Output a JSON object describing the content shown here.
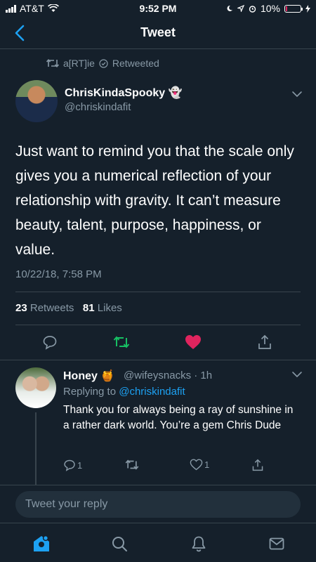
{
  "status": {
    "carrier": "AT&T",
    "time": "9:52 PM",
    "battery": "10%"
  },
  "header": {
    "title": "Tweet"
  },
  "retweet": {
    "label": "a[RT]ie",
    "suffix": "Retweeted"
  },
  "tweet": {
    "name": "ChrisKindaSpooky",
    "handle": "@chriskindafit",
    "text": "Just want to remind you that the scale only gives you a numerical reflection of your relationship with gravity. It can’t measure beauty, talent, purpose, happiness, or value.",
    "timestamp": "10/22/18, 7:58 PM",
    "retweets_count": "23",
    "retweets_label": "Retweets",
    "likes_count": "81",
    "likes_label": "Likes"
  },
  "reply": {
    "name": "Honey",
    "handle_time": "@wifeysnacks · 1h",
    "replying_prefix": "Replying to",
    "replying_handle": "@chriskindafit",
    "text": "Thank you for always being a ray of sunshine in a rather dark world. You’re a gem Chris Dude",
    "reply_count": "1",
    "like_count": "1"
  },
  "compose": {
    "placeholder": "Tweet your reply"
  },
  "colors": {
    "background": "#15202b",
    "accent": "#1da1f2",
    "retweet_green": "#17bf63",
    "like_red": "#e0245e",
    "muted": "#8899a6"
  }
}
